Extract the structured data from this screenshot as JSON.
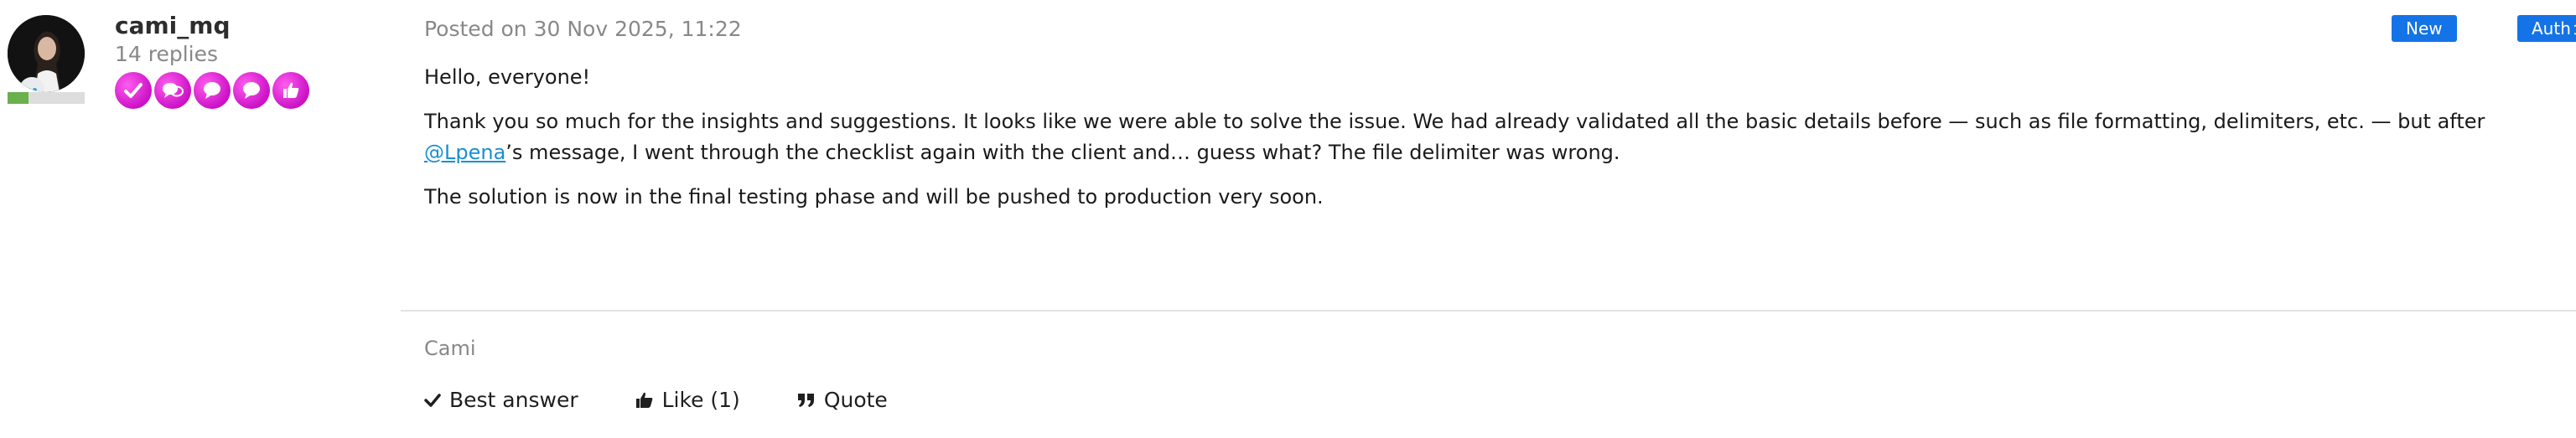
{
  "author": {
    "username": "cami_mq",
    "replies": "14 replies",
    "badges": [
      "check-badge-icon",
      "speech-bubbles-badge-icon",
      "speech-bubble-badge-icon",
      "speech-bubble-badge-icon",
      "thumbs-up-badge-icon"
    ],
    "rank_progress": 0.27,
    "colors": {
      "badge": "#e020d8",
      "rank": "#6ab04c"
    }
  },
  "post": {
    "date": "Posted on 30 Nov 2025, 11:22",
    "tags": [
      "New",
      "Author"
    ],
    "paragraph_1": "Hello, everyone!",
    "paragraph_2_part1": "Thank you so much for the insights and suggestions. It looks like we were able to solve the issue. We had already validated all the basic details before — such as file formatting, delimiters, etc. — but after ",
    "mention": "@Lpena",
    "paragraph_2_part2": "’s message, I went through the checklist again with the client and… guess what? The file delimiter was wrong.",
    "paragraph_3": "The solution is now in the final testing phase and will be pushed to production very soon.",
    "signature": "Cami",
    "colors": {
      "tag": "#1473e6",
      "link": "#1a8fd0"
    }
  },
  "actions": {
    "best_answer": "Best answer",
    "like": "Like (1)",
    "quote": "Quote"
  }
}
